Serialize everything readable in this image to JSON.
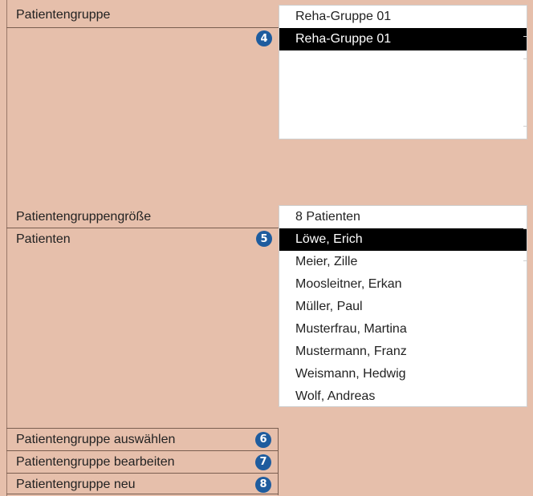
{
  "fields": {
    "group_label": "Patientengruppe",
    "size_label": "Patientengruppengröße",
    "patients_label": "Patienten"
  },
  "group": {
    "header_value": "Reha-Gruppe 01",
    "items": [
      "Reha-Gruppe 01"
    ],
    "selected_index": 0,
    "badge": "4"
  },
  "size": {
    "value": "8 Patienten"
  },
  "patients": {
    "items": [
      "Löwe, Erich",
      "Meier, Zille",
      "Moosleitner, Erkan",
      "Müller, Paul",
      "Musterfrau, Martina",
      "Mustermann, Franz",
      "Weismann, Hedwig",
      "Wolf, Andreas"
    ],
    "selected_index": 0,
    "badge": "5"
  },
  "actions": [
    {
      "label": "Patientengruppe auswählen",
      "badge": "6"
    },
    {
      "label": "Patientengruppe bearbeiten",
      "badge": "7"
    },
    {
      "label": "Patientengruppe neu",
      "badge": "8"
    }
  ],
  "colors": {
    "background": "#e6bfab",
    "badge": "#1e5c9e",
    "selection": "#000000"
  }
}
